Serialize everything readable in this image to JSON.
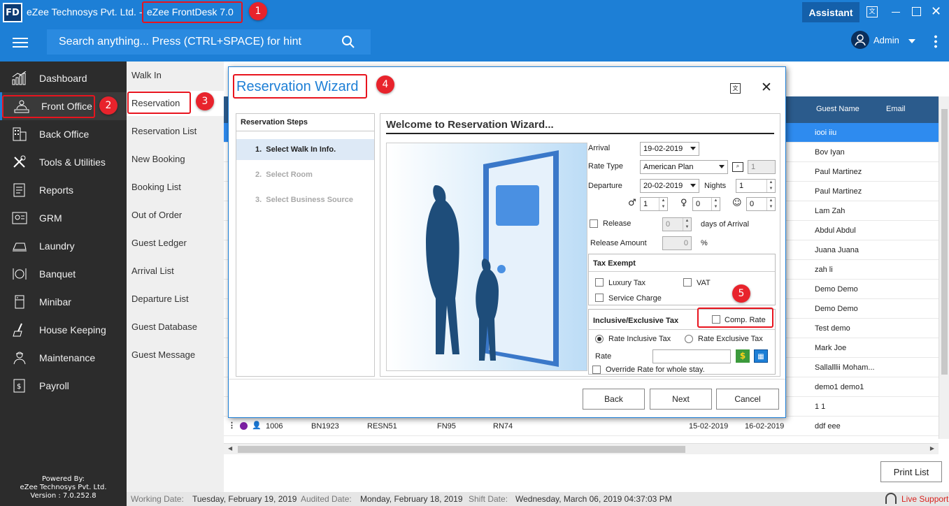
{
  "titlebar": {
    "app_logo": "FD",
    "company": "eZee Technosys Pvt. Ltd. -",
    "product": "eZee FrontDesk 7.0",
    "assistant_label": "Assistant",
    "user_label": "Admin"
  },
  "search": {
    "placeholder": "Search anything... Press (CTRL+SPACE) for hint"
  },
  "sidebar": {
    "items": [
      {
        "label": "Dashboard",
        "icon": "dashboard-icon"
      },
      {
        "label": "Front Office",
        "icon": "front-office-icon"
      },
      {
        "label": "Back Office",
        "icon": "back-office-icon"
      },
      {
        "label": "Tools & Utilities",
        "icon": "tools-icon"
      },
      {
        "label": "Reports",
        "icon": "reports-icon"
      },
      {
        "label": "GRM",
        "icon": "grm-icon"
      },
      {
        "label": "Laundry",
        "icon": "laundry-icon"
      },
      {
        "label": "Banquet",
        "icon": "banquet-icon"
      },
      {
        "label": "Minibar",
        "icon": "minibar-icon"
      },
      {
        "label": "House Keeping",
        "icon": "housekeeping-icon"
      },
      {
        "label": "Maintenance",
        "icon": "maintenance-icon"
      },
      {
        "label": "Payroll",
        "icon": "payroll-icon"
      }
    ],
    "powered_by": "Powered By:",
    "company": "eZee Technosys Pvt. Ltd.",
    "version": "Version : 7.0.252.8"
  },
  "submenu": {
    "items": [
      "Walk In",
      "Reservation",
      "Reservation List",
      "New Booking",
      "Booking List",
      "Out of Order",
      "Guest Ledger",
      "Arrival List",
      "Departure List",
      "Guest Database",
      "Guest Message"
    ]
  },
  "grid": {
    "headers": {
      "guest_name": "Guest Name",
      "email": "Email"
    },
    "rows": [
      {
        "guest": "iooi iiu"
      },
      {
        "guest": "Bov Iyan"
      },
      {
        "guest": "Paul Martinez"
      },
      {
        "guest": "Paul Martinez"
      },
      {
        "guest": "Lam Zah"
      },
      {
        "guest": "Abdul Abdul"
      },
      {
        "guest": "Juana Juana"
      },
      {
        "guest": "zah li"
      },
      {
        "guest": "Demo Demo"
      },
      {
        "guest": "Demo Demo"
      },
      {
        "guest": "Test demo"
      },
      {
        "guest": "Mark Joe"
      },
      {
        "guest": "Sallalllii Moham..."
      },
      {
        "guest": "demo1 demo1"
      },
      {
        "guest": "1 1"
      }
    ],
    "last_row": {
      "id": "1006",
      "booking": "BN1923",
      "res": "RESN51",
      "folio": "FN95",
      "room": "RN74",
      "arrival": "15-02-2019",
      "departure": "16-02-2019",
      "guest": "ddf eee"
    }
  },
  "print_list": "Print List",
  "statusbar": {
    "working_label": "Working Date:",
    "working_value": "Tuesday, February 19, 2019",
    "audited_label": "Audited Date:",
    "audited_value": "Monday, February 18, 2019",
    "shift_label": "Shift Date:",
    "shift_value": "Wednesday, March 06, 2019 04:37:03 PM",
    "live_support": "Live Support"
  },
  "dialog": {
    "title": "Reservation Wizard",
    "steps_header": "Reservation Steps",
    "steps": [
      "1.  Select Walk In Info.",
      "2.  Select Room",
      "3.  Select Business Source"
    ],
    "welcome": "Welcome to Reservation Wizard...",
    "arrival_label": "Arrival",
    "arrival_value": "19-02-2019",
    "ratetype_label": "Rate Type",
    "ratetype_value": "American Plan",
    "ratetype_num": "1",
    "departure_label": "Departure",
    "departure_value": "20-02-2019",
    "nights_label": "Nights",
    "nights_value": "1",
    "adult_value": "1",
    "child_value": "0",
    "infant_value": "0",
    "release_label": "Release",
    "release_value": "0",
    "days_of_arrival": "days of Arrival",
    "release_amount_label": "Release Amount",
    "release_amount_value": "0",
    "percent": "%",
    "tax_exempt": "Tax Exempt",
    "luxury_tax": "Luxury Tax",
    "vat": "VAT",
    "service_charge": "Service Charge",
    "incl_excl": "Inclusive/Exclusive Tax",
    "comp_rate": "Comp. Rate",
    "rate_inclusive": "Rate Inclusive Tax",
    "rate_exclusive": "Rate Exclusive Tax",
    "rate_label": "Rate",
    "override": "Override Rate for whole stay.",
    "back": "Back",
    "next": "Next",
    "cancel": "Cancel"
  },
  "annotations": [
    "1",
    "2",
    "3",
    "4",
    "5"
  ],
  "colors": {
    "topbar": "#1d7fd6",
    "sidebar": "#2c2c2c",
    "highlight": "#e8141e"
  }
}
